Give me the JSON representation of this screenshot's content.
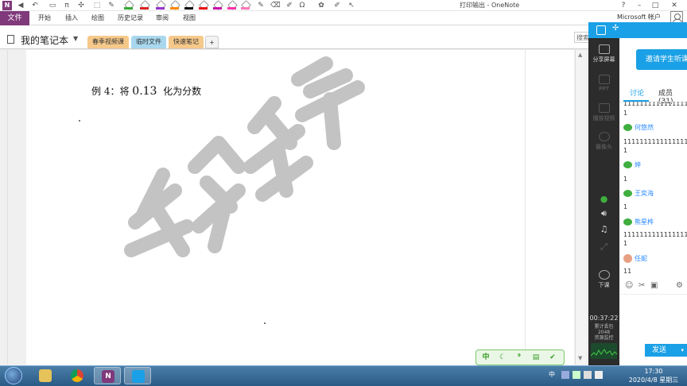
{
  "app": {
    "title": "打印输出 - OneNote",
    "logo_letter": "N",
    "account_label": "Microsoft 帐户"
  },
  "window_controls": {
    "help": "?",
    "minimize": "–",
    "maximize": "□",
    "close": "✕"
  },
  "ribbon": {
    "file_tab": "文件",
    "tabs": [
      "开始",
      "插入",
      "绘图",
      "历史记录",
      "审阅",
      "视图"
    ]
  },
  "notebook": {
    "name": "我的笔记本",
    "sections": [
      {
        "label": "春季视频课",
        "color": "#f6c98a"
      },
      {
        "label": "临时文件",
        "color": "#a9d8ee"
      },
      {
        "label": "快速笔记",
        "color": "#f6c98a"
      }
    ],
    "add_section_label": "+",
    "search_placeholder": "搜索"
  },
  "page": {
    "example_prefix": "例 4：将",
    "example_number": "0.13",
    "example_suffix": "化为分数"
  },
  "float_toolbar": {
    "lang_label": "中"
  },
  "classroom": {
    "share_screen_label": "分享屏幕",
    "ppt_label": "PPT",
    "play_video_label": "播放视频",
    "camera_label": "摄像头",
    "end_class_label": "下课",
    "invite_button": "邀请学生听课",
    "tabs": {
      "discuss": "讨论",
      "members": "成员(31)"
    },
    "chat": [
      {
        "type": "text",
        "text": "1111111111111111"
      },
      {
        "type": "text",
        "text": "1"
      },
      {
        "type": "sender",
        "name": "何悠然"
      },
      {
        "type": "text",
        "text": "1111111111111111"
      },
      {
        "type": "text",
        "text": "1"
      },
      {
        "type": "sender",
        "name": "婷"
      },
      {
        "type": "text",
        "text": "1"
      },
      {
        "type": "sender",
        "name": "王奕海"
      },
      {
        "type": "text",
        "text": "1"
      },
      {
        "type": "sender",
        "name": "熊星桦"
      },
      {
        "type": "text",
        "text": "1111111111111111"
      },
      {
        "type": "text",
        "text": "1"
      },
      {
        "type": "sender",
        "name": "任妮",
        "avatar": true
      },
      {
        "type": "text",
        "text": "11"
      }
    ],
    "send_button": "发送",
    "timer": "00:37:22",
    "stats_line1": "累计丢包",
    "stats_line2": "2048",
    "stats_line3": "资源监控"
  },
  "taskbar": {
    "ime": "中",
    "time": "17:30",
    "date": "2020/4/8 星期三"
  },
  "colors": {
    "onenote_purple": "#80397b",
    "classroom_blue": "#1aa0e6",
    "chat_green": "#3fae3f"
  }
}
